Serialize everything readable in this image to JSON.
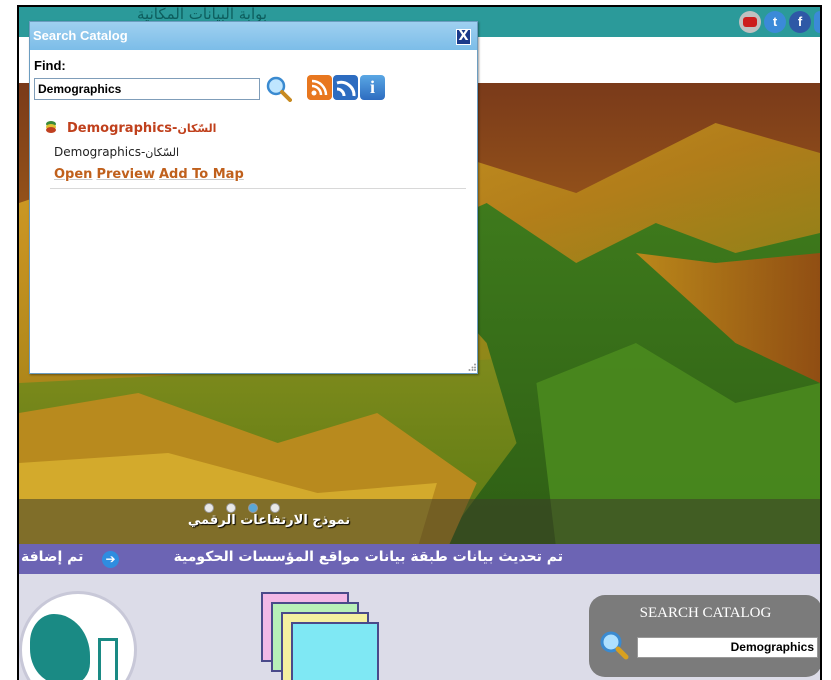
{
  "header": {
    "portal_title": "بوابة البيانات المكانية",
    "social_icons": [
      "youtube-icon",
      "twitter-icon",
      "facebook-icon"
    ]
  },
  "hero": {
    "slide_caption": "نموذج الارتفاعات الرقمي",
    "dots": 4,
    "active_dot": 3
  },
  "ticker": {
    "text_left": "تم إضافة",
    "text_main": "تم تحديث بيانات طبقة بيانات مواقع المؤسسات الحكومية"
  },
  "catalog_box": {
    "title": "SEARCH CATALOG",
    "input_value": "Demographics"
  },
  "dialog": {
    "title": "Search Catalog",
    "close_label": "X",
    "find_label": "Find:",
    "find_value": "Demographics",
    "info_label": "i",
    "result": {
      "title_en": "Demographics-",
      "title_ar": "السّكان",
      "subtitle_en": "Demographics-",
      "subtitle_ar": "السّكان",
      "actions": [
        "Open",
        "Preview",
        "Add To Map"
      ]
    }
  },
  "colors": {
    "ticker_bg": "#6c64b4",
    "dialog_title_bg": "#7cbde8",
    "result_title": "#c0401c",
    "header_band": "#2b9a9a"
  }
}
